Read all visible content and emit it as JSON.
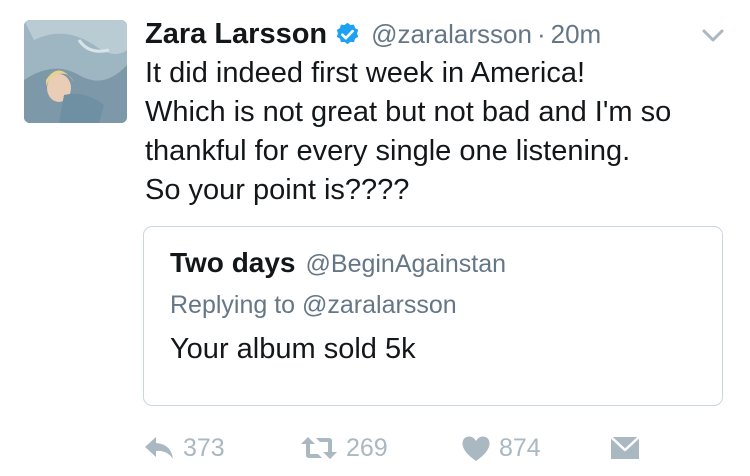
{
  "tweet": {
    "author_name": "Zara Larsson",
    "handle": "@zaralarsson",
    "separator": "·",
    "time": "20m",
    "lines": [
      "It did indeed first week in America!",
      "Which is not great but not bad and I'm so",
      "thankful for every single one listening.",
      "So your point is????"
    ]
  },
  "quoted": {
    "author_name": "Two days",
    "handle": "@BeginAgainstan",
    "replying_to": "Replying to @zaralarsson",
    "text": "Your album sold 5k"
  },
  "actions": {
    "reply_count": "373",
    "retweet_count": "269",
    "like_count": "874"
  },
  "icons": {
    "verified": "verified-badge-icon",
    "caret": "chevron-down-icon",
    "reply": "reply-icon",
    "retweet": "retweet-icon",
    "like": "heart-icon",
    "dm": "envelope-icon"
  },
  "colors": {
    "verified": "#1da1f2",
    "muted": "#657786",
    "action": "#aab8c2",
    "border": "#ccd6dd"
  }
}
